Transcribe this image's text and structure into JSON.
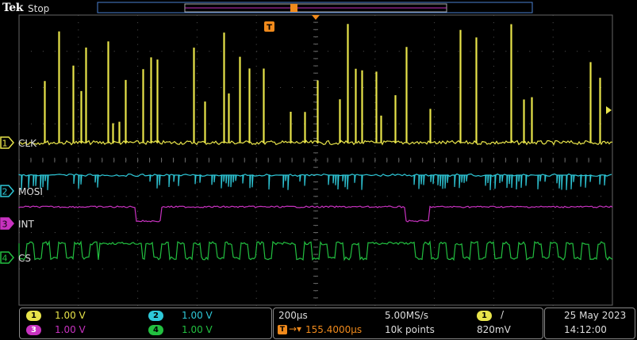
{
  "header": {
    "brand": "Tek",
    "acq_state": "Stop",
    "trigger_marker": "T"
  },
  "channels": [
    {
      "id": "1",
      "label": "CLK",
      "color": "#e8e44a"
    },
    {
      "id": "2",
      "label": "MOSI",
      "color": "#2ec8d8"
    },
    {
      "id": "3",
      "label": "INT",
      "color": "#c832c0"
    },
    {
      "id": "4",
      "label": "CS",
      "color": "#22c040"
    }
  ],
  "status_bar": {
    "ch1_scale": "1.00 V",
    "ch2_scale": "1.00 V",
    "ch3_scale": "1.00 V",
    "ch4_scale": "1.00 V",
    "timebase": "200µs",
    "sample_rate": "5.00MS/s",
    "trigger_position": "155.4000µs",
    "record_length": "10k points",
    "trigger_source": "1",
    "trigger_slope": "/",
    "trigger_level": "820mV",
    "date": "25 May 2023",
    "time": "14:12:00"
  }
}
